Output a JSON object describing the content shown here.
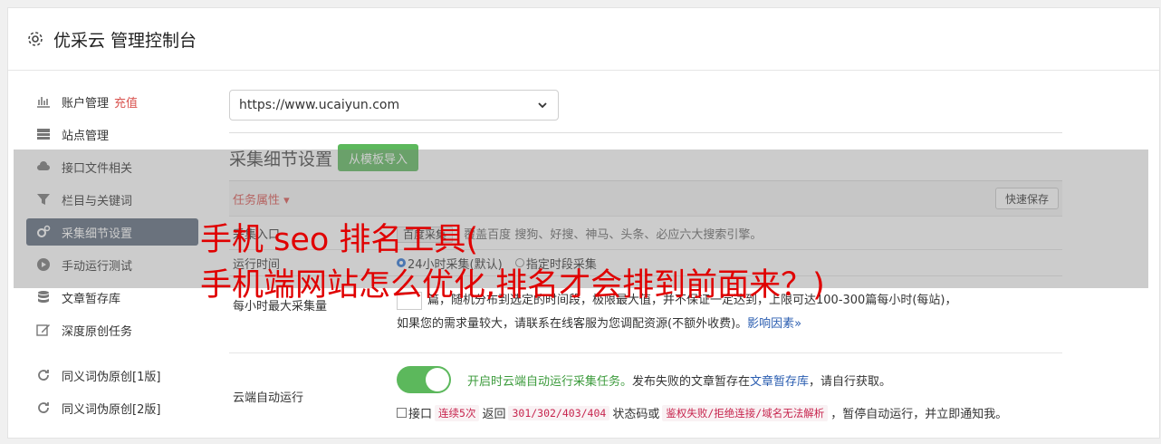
{
  "header": {
    "title": "优采云 管理控制台",
    "icon": "gear-icon"
  },
  "sidebar": {
    "items": [
      {
        "label": "账户管理",
        "extra": "充值",
        "icon": "bar-chart-icon"
      },
      {
        "label": "站点管理",
        "icon": "server-icon"
      },
      {
        "label": "接口文件相关",
        "icon": "cloud-upload-icon"
      },
      {
        "label": "栏目与关键词",
        "icon": "filter-icon"
      },
      {
        "label": "采集细节设置",
        "icon": "gears-icon",
        "active": true
      },
      {
        "label": "手动运行测试",
        "icon": "play-circle-icon"
      },
      {
        "label": "文章暂存库",
        "icon": "database-icon"
      },
      {
        "label": "深度原创任务",
        "icon": "edit-icon"
      },
      {
        "label": "同义词伪原创[1版]",
        "icon": "refresh-icon"
      },
      {
        "label": "同义词伪原创[2版]",
        "icon": "refresh-icon"
      }
    ]
  },
  "main": {
    "site_select": "https://www.ucaiyun.com",
    "section_title": "采集细节设置",
    "import_button": "从模板导入",
    "table_header": "任务属性 ▾",
    "quick_save": "快速保存",
    "rows": {
      "entry": {
        "label": "采集入口",
        "tag": "百度采集",
        "text1": "覆盖百度",
        "text2": "搜狗、好搜、神马、头条、必应六大搜索引擎。"
      },
      "runtime": {
        "label": "运行时间",
        "opt1": "24小时采集(默认)",
        "opt2": "指定时段采集"
      },
      "max": {
        "label": "每小时最大采集量",
        "line1": "篇，随机分布到选定的时间段，极限最大值，并不保证一定达到，上限可达100-300篇每小时(每站)，",
        "line2": "如果您的需求量较大，请联系在线客服为您调配资源(不额外收费)。",
        "link": "影响因素»"
      },
      "cloud": {
        "label": "云端自动运行",
        "green": "开启时云端自动运行采集任务。",
        "text1": "发布失败的文章暂存在",
        "link": "文章暂存库",
        "text2": "，请自行获取。",
        "cb_label": "接口",
        "code1": "连续5次",
        "t_back": "返回",
        "code2": "301/302/403/404",
        "t_status": "状态码或",
        "code3": "鉴权失败/拒绝连接/域名无法解析",
        "t_end": "，暂停自动运行，并立即通知我。"
      }
    }
  },
  "overlay_text": {
    "line1": "手机 seo 排名工具(",
    "line2": "手机端网站怎么优化,排名才会排到前面来？)"
  },
  "colors": {
    "accent_green": "#5cb85c",
    "active_nav": "#5c6a7c",
    "headline_red": "#e00000"
  }
}
